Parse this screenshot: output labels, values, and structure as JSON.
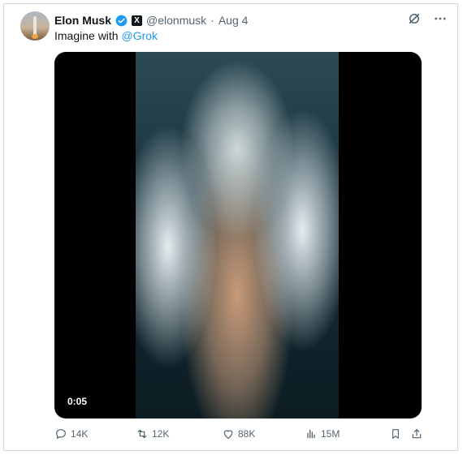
{
  "author": {
    "name": "Elon Musk",
    "handle": "@elonmusk",
    "separator": "·",
    "date": "Aug 4",
    "verified_color": "#1d9bf0"
  },
  "tweet": {
    "text_prefix": "Imagine with ",
    "mention": "@Grok",
    "mention_color": "#1d9bf0"
  },
  "media": {
    "type": "video",
    "duration": "0:05"
  },
  "actions": {
    "replies": "14K",
    "retweets": "12K",
    "likes": "88K",
    "views": "15M"
  },
  "icons": [
    "grok-icon",
    "more-icon",
    "reply-icon",
    "retweet-icon",
    "like-icon",
    "views-icon",
    "bookmark-icon",
    "share-icon"
  ]
}
